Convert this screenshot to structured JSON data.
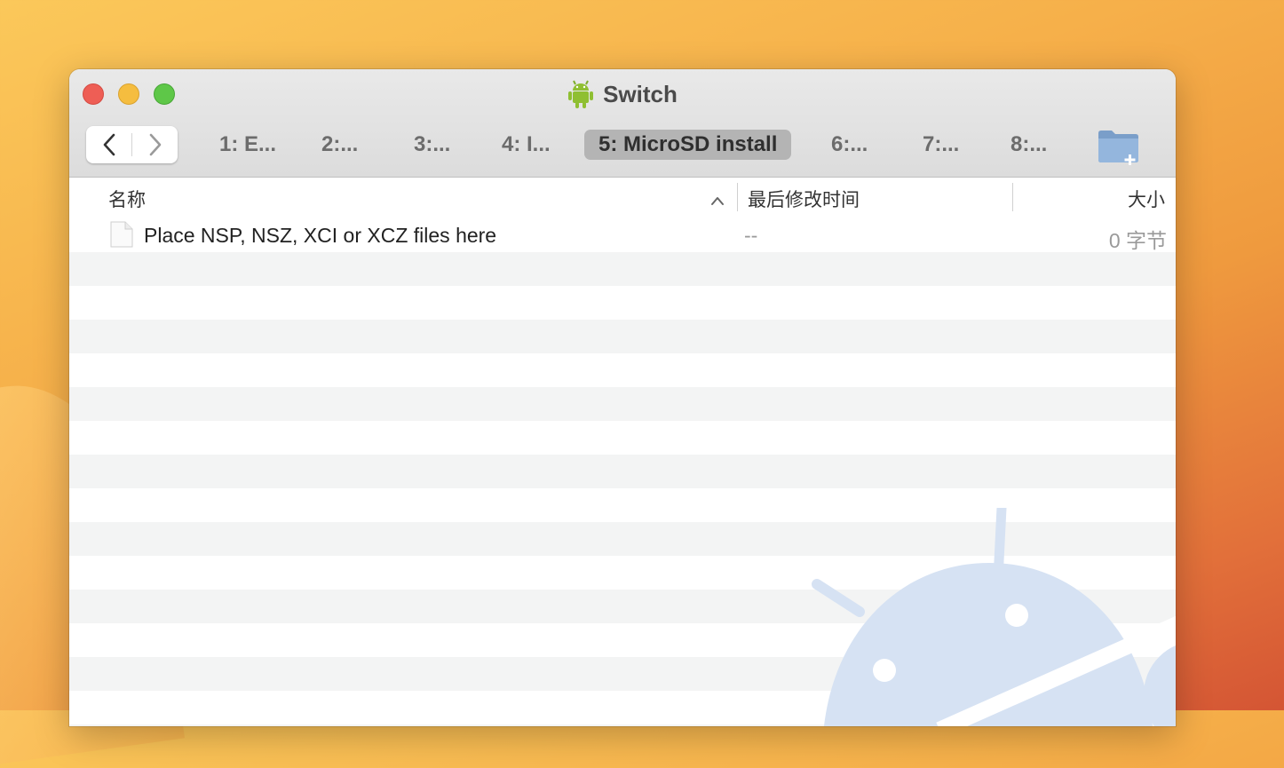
{
  "window": {
    "title": "Switch",
    "app_icon": "android-icon"
  },
  "toolbar": {
    "back_icon": "chevron-left-icon",
    "forward_icon": "chevron-right-icon",
    "new_folder_icon": "new-folder-icon",
    "tabs": [
      {
        "label": "1: E..."
      },
      {
        "label": "2:..."
      },
      {
        "label": "3:..."
      },
      {
        "label": "4: I..."
      },
      {
        "label": "5: MicroSD install",
        "active": true
      },
      {
        "label": "6:..."
      },
      {
        "label": "7:..."
      },
      {
        "label": "8:..."
      }
    ]
  },
  "columns": {
    "name": "名称",
    "modified": "最后修改时间",
    "size": "大小",
    "sort_indicator": "chevron-up-icon"
  },
  "files": [
    {
      "name": "Place NSP, NSZ, XCI or XCZ files here",
      "modified": "--",
      "size": "0 字节",
      "icon": "document-icon"
    }
  ],
  "colors": {
    "accent_tab": "#b4b4b4",
    "stripe": "#f3f4f4",
    "watermark": "#d6e2f3"
  }
}
